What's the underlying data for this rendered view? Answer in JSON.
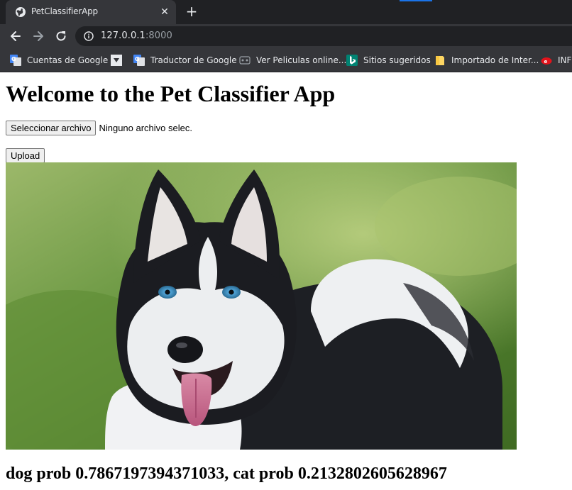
{
  "browser": {
    "tab_title": "PetClassifierApp",
    "url_host": "127.0.0.1",
    "url_port": ":8000",
    "bookmarks": [
      {
        "label": "Cuentas de Google",
        "icon": "google-translate-icon"
      },
      {
        "label": "",
        "icon": "folder-down-icon"
      },
      {
        "label": "Traductor de Google",
        "icon": "google-translate-icon"
      },
      {
        "label": "Ver Peliculas online...",
        "icon": "movie-icon"
      },
      {
        "label": "Sitios sugeridos",
        "icon": "bing-icon"
      },
      {
        "label": "Importado de Inter...",
        "icon": "folder-icon"
      },
      {
        "label": "INFO",
        "icon": "red-logo-icon"
      }
    ]
  },
  "page": {
    "heading": "Welcome to the Pet Classifier App",
    "file_button_label": "Seleccionar archivo",
    "file_status": "Ninguno archivo selec.",
    "upload_button_label": "Upload",
    "image_alt": "husky dog photo",
    "result_text": "dog prob 0.7867197394371033, cat prob 0.2132802605628967"
  },
  "colors": {
    "tabstrip": "#202124",
    "toolbar": "#35363a",
    "accent": "#1a73e8"
  }
}
